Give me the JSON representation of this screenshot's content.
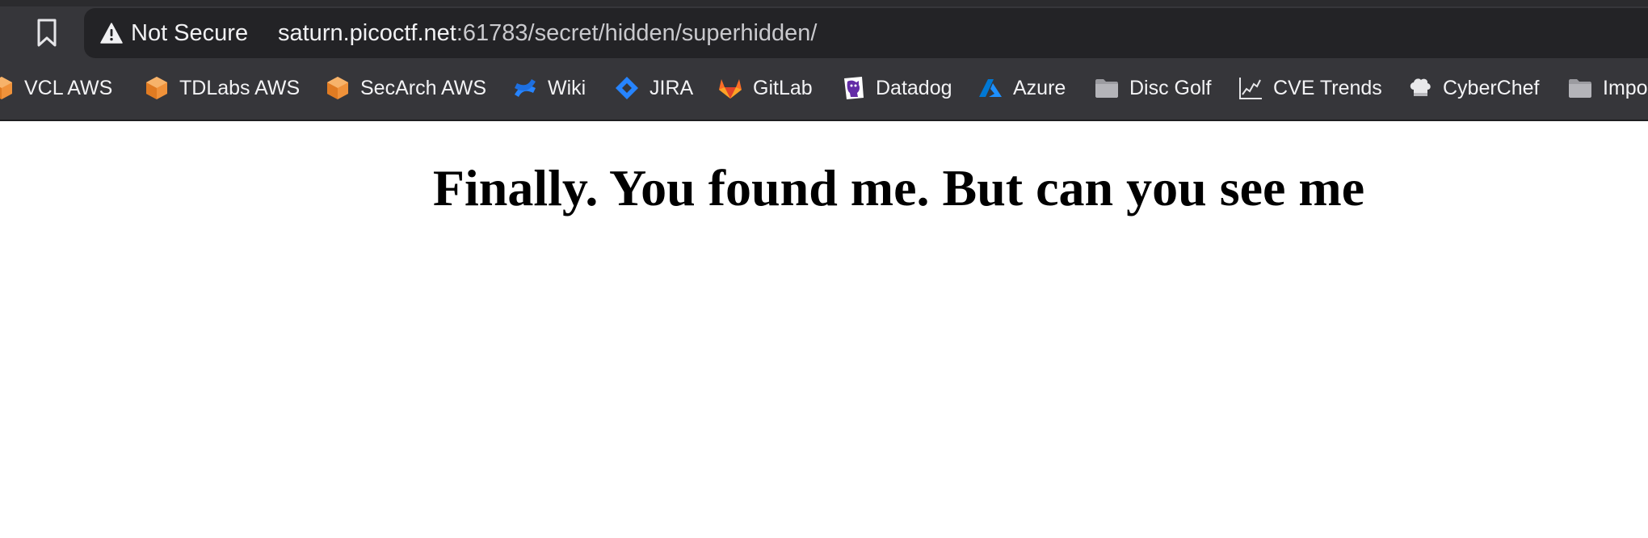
{
  "address_bar": {
    "security_label": "Not Secure",
    "url_host": "saturn.picoctf.net",
    "url_rest": ":61783/secret/hidden/superhidden/"
  },
  "bookmarks": [
    {
      "label": "VCL AWS",
      "icon": "aws-cube-icon"
    },
    {
      "label": "TDLabs AWS",
      "icon": "aws-cube-icon"
    },
    {
      "label": "SecArch AWS",
      "icon": "aws-cube-icon"
    },
    {
      "label": "Wiki",
      "icon": "confluence-icon"
    },
    {
      "label": "JIRA",
      "icon": "jira-icon"
    },
    {
      "label": "GitLab",
      "icon": "gitlab-icon"
    },
    {
      "label": "Datadog",
      "icon": "datadog-icon"
    },
    {
      "label": "Azure",
      "icon": "azure-icon"
    },
    {
      "label": "Disc Golf",
      "icon": "folder-icon"
    },
    {
      "label": "CVE Trends",
      "icon": "chart-line-icon"
    },
    {
      "label": "CyberChef",
      "icon": "chef-hat-icon"
    },
    {
      "label": "Impo",
      "icon": "folder-icon"
    }
  ],
  "colors": {
    "chrome_bg": "#36363a",
    "address_bg": "#232326",
    "aws_orange": "#f0923a",
    "jira_blue": "#2684ff",
    "gitlab_orange": "#fc6d26",
    "datadog_purple": "#632ca6",
    "azure_blue": "#0078d4"
  },
  "page": {
    "heading": "Finally. You found me. But can you see me"
  }
}
